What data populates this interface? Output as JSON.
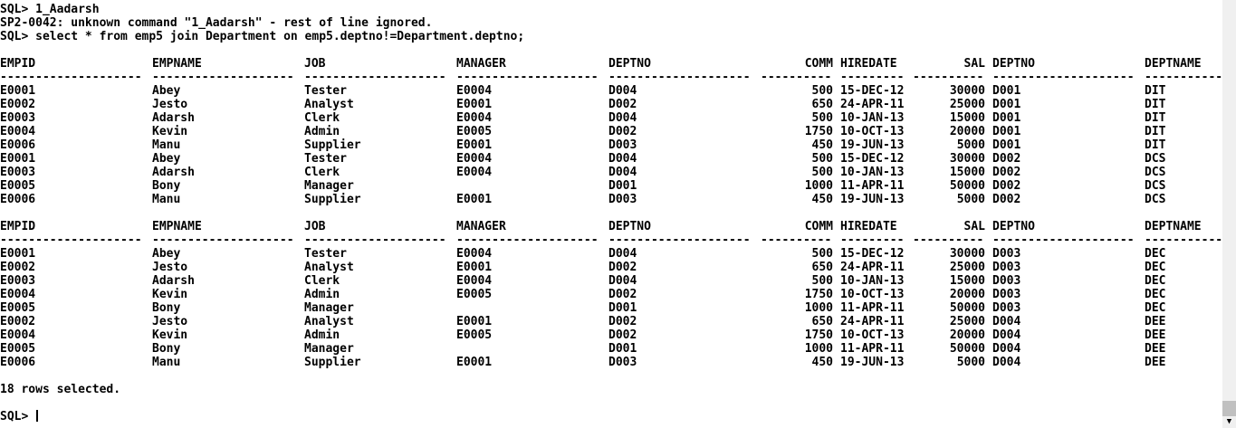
{
  "console": {
    "lines_top": [
      "SQL> 1_Aadarsh",
      "SP2-0042: unknown command \"1_Aadarsh\" - rest of line ignored.",
      "SQL> select * from emp5 join Department on emp5.deptno!=Department.deptno;"
    ],
    "footer": "18 rows selected.",
    "prompt": "SQL> "
  },
  "table": {
    "headers": [
      "EMPID",
      "EMPNAME",
      "JOB",
      "MANAGER",
      "DEPTNO",
      "COMM",
      "HIREDATE",
      "SAL",
      "DEPTNO",
      "DEPTNAME"
    ],
    "pages": [
      [
        [
          "E0001",
          "Abey",
          "Tester",
          "E0004",
          "D004",
          "500",
          "15-DEC-12",
          "30000",
          "D001",
          "DIT"
        ],
        [
          "E0002",
          "Jesto",
          "Analyst",
          "E0001",
          "D002",
          "650",
          "24-APR-11",
          "25000",
          "D001",
          "DIT"
        ],
        [
          "E0003",
          "Adarsh",
          "Clerk",
          "E0004",
          "D004",
          "500",
          "10-JAN-13",
          "15000",
          "D001",
          "DIT"
        ],
        [
          "E0004",
          "Kevin",
          "Admin",
          "E0005",
          "D002",
          "1750",
          "10-OCT-13",
          "20000",
          "D001",
          "DIT"
        ],
        [
          "E0006",
          "Manu",
          "Supplier",
          "E0001",
          "D003",
          "450",
          "19-JUN-13",
          "5000",
          "D001",
          "DIT"
        ],
        [
          "E0001",
          "Abey",
          "Tester",
          "E0004",
          "D004",
          "500",
          "15-DEC-12",
          "30000",
          "D002",
          "DCS"
        ],
        [
          "E0003",
          "Adarsh",
          "Clerk",
          "E0004",
          "D004",
          "500",
          "10-JAN-13",
          "15000",
          "D002",
          "DCS"
        ],
        [
          "E0005",
          "Bony",
          "Manager",
          "",
          "D001",
          "1000",
          "11-APR-11",
          "50000",
          "D002",
          "DCS"
        ],
        [
          "E0006",
          "Manu",
          "Supplier",
          "E0001",
          "D003",
          "450",
          "19-JUN-13",
          "5000",
          "D002",
          "DCS"
        ]
      ],
      [
        [
          "E0001",
          "Abey",
          "Tester",
          "E0004",
          "D004",
          "500",
          "15-DEC-12",
          "30000",
          "D003",
          "DEC"
        ],
        [
          "E0002",
          "Jesto",
          "Analyst",
          "E0001",
          "D002",
          "650",
          "24-APR-11",
          "25000",
          "D003",
          "DEC"
        ],
        [
          "E0003",
          "Adarsh",
          "Clerk",
          "E0004",
          "D004",
          "500",
          "10-JAN-13",
          "15000",
          "D003",
          "DEC"
        ],
        [
          "E0004",
          "Kevin",
          "Admin",
          "E0005",
          "D002",
          "1750",
          "10-OCT-13",
          "20000",
          "D003",
          "DEC"
        ],
        [
          "E0005",
          "Bony",
          "Manager",
          "",
          "D001",
          "1000",
          "11-APR-11",
          "50000",
          "D003",
          "DEC"
        ],
        [
          "E0002",
          "Jesto",
          "Analyst",
          "E0001",
          "D002",
          "650",
          "24-APR-11",
          "25000",
          "D004",
          "DEE"
        ],
        [
          "E0004",
          "Kevin",
          "Admin",
          "E0005",
          "D002",
          "1750",
          "10-OCT-13",
          "20000",
          "D004",
          "DEE"
        ],
        [
          "E0005",
          "Bony",
          "Manager",
          "",
          "D001",
          "1000",
          "11-APR-11",
          "50000",
          "D004",
          "DEE"
        ],
        [
          "E0006",
          "Manu",
          "Supplier",
          "E0001",
          "D003",
          "450",
          "19-JUN-13",
          "5000",
          "D004",
          "DEE"
        ]
      ]
    ]
  },
  "scrollbar": {
    "down_icon": "chevron-down-icon"
  }
}
